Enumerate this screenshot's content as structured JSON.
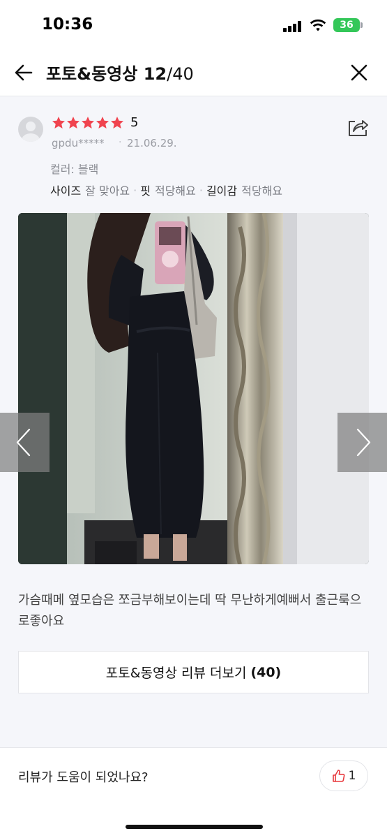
{
  "status_bar": {
    "time": "10:36",
    "battery": "36",
    "icons": [
      "signal-icon",
      "wifi-icon",
      "battery-icon"
    ]
  },
  "nav": {
    "title": "포토&동영상",
    "counter_current": "12",
    "counter_separator": "/",
    "counter_total": "40",
    "icons": [
      "arrow-left-icon",
      "close-icon"
    ]
  },
  "review": {
    "rating": "5",
    "stars_filled": 5,
    "star_color": "#f0444f",
    "reviewer": "gpdu*****",
    "separator": "·",
    "date": "21.06.29.",
    "option": "컬러: 블랙",
    "attributes": [
      {
        "key": "사이즈",
        "value": "잘 맞아요"
      },
      {
        "key": "핏",
        "value": "적당해요"
      },
      {
        "key": "길이감",
        "value": "적당해요"
      }
    ],
    "text": "가슴때메 옆모습은 쪼금부해보이는데 딱 무난하게예뻐서 출근룩으로좋아요",
    "share_icon": "share-icon"
  },
  "gallery": {
    "prev_icon": "chevron-left-icon",
    "next_icon": "chevron-right-icon"
  },
  "more_button": {
    "label": "포토&동영상 리뷰 더보기",
    "count": "(40)"
  },
  "helpful": {
    "question": "리뷰가 도움이 되었나요?",
    "like_count": "1",
    "like_icon": "thumbs-up-icon",
    "accent": "#e8383d"
  }
}
